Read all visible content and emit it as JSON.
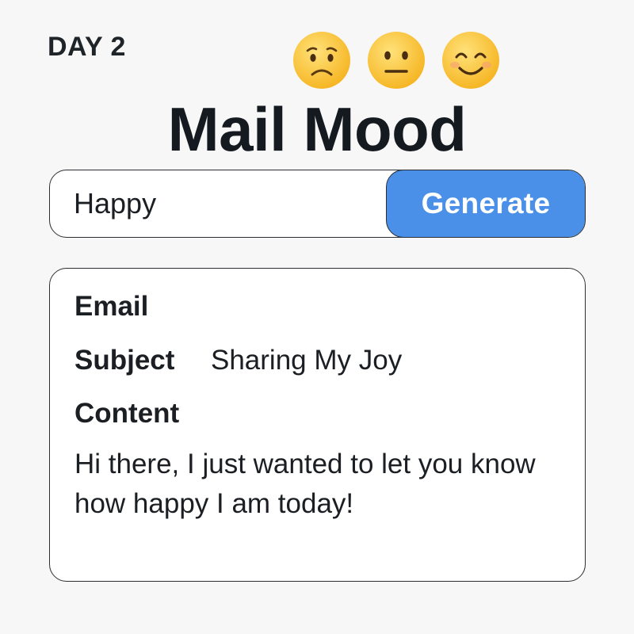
{
  "header": {
    "day_label": "DAY 2",
    "title": "Mail Mood"
  },
  "moods": [
    {
      "name": "worried-face-icon"
    },
    {
      "name": "neutral-face-icon"
    },
    {
      "name": "smiling-face-icon"
    }
  ],
  "form": {
    "mood_value": "Happy",
    "generate_label": "Generate"
  },
  "email": {
    "heading": "Email",
    "subject_label": "Subject",
    "subject_value": "Sharing My Joy",
    "content_label": "Content",
    "content_text": "Hi there, I just wanted to let you know how happy I am today!"
  },
  "colors": {
    "accent": "#4a90e8",
    "background": "#f7f7f7",
    "emoji_yellow": "#fbc93b"
  }
}
